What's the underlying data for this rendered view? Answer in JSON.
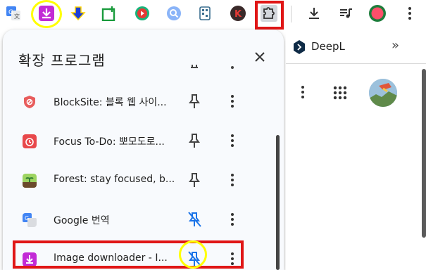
{
  "panel": {
    "title": "확장 프로그램",
    "items": [
      {
        "name": "BlockSite: 블록 웹 사이...",
        "pinned": false
      },
      {
        "name": "Focus To-Do: 뽀모도로...",
        "pinned": false
      },
      {
        "name": "Forest: stay focused, b...",
        "pinned": false
      },
      {
        "name": "Google 번역",
        "pinned": true
      },
      {
        "name": "Image downloader - I...",
        "pinned": true
      }
    ]
  },
  "side_tab": {
    "title": "DeepL",
    "expand": "»"
  },
  "colors": {
    "highlight_red": "#e01616",
    "highlight_yellow": "#ffff00",
    "pinned_blue": "#1a73e8"
  }
}
